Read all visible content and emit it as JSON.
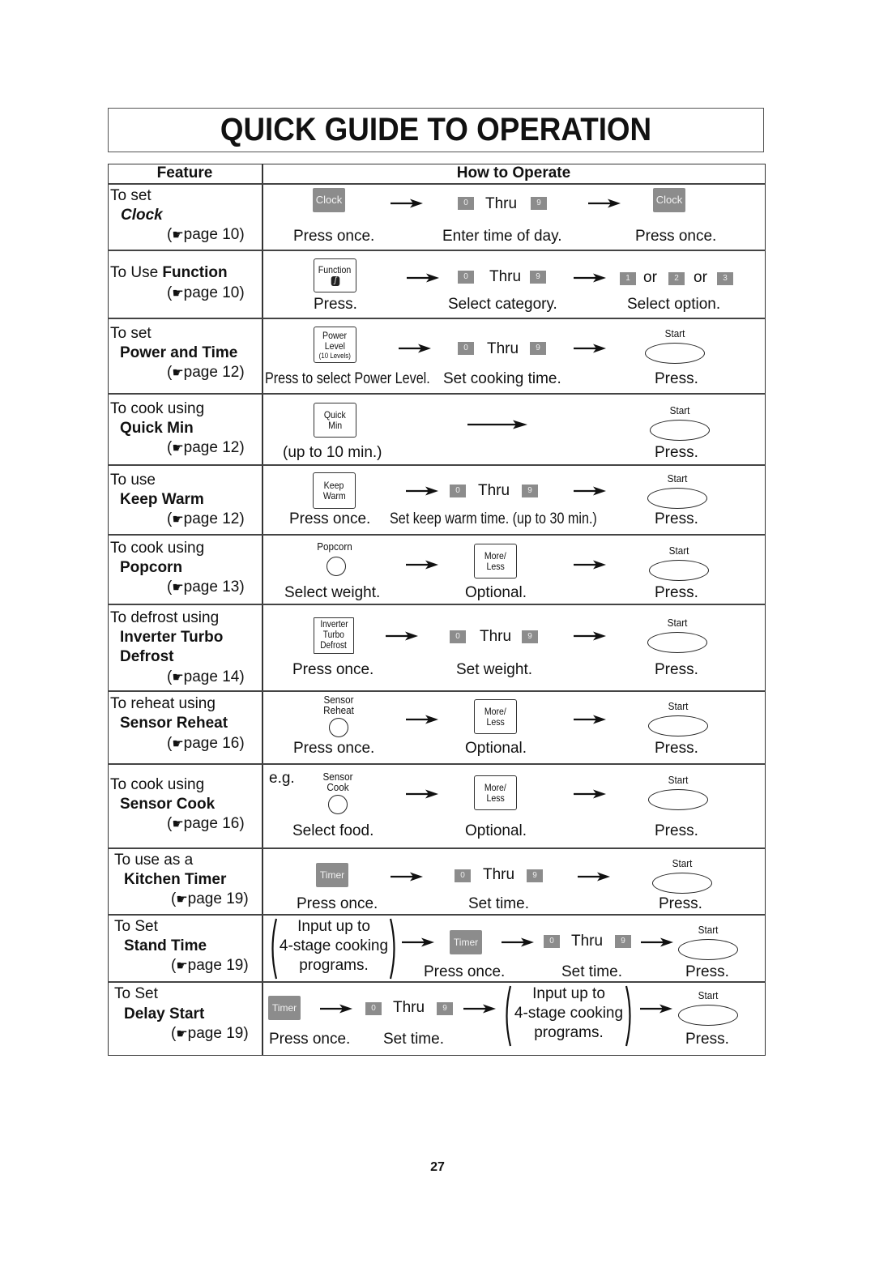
{
  "title": "QUICK GUIDE TO OPERATION",
  "header": {
    "feature": "Feature",
    "how": "How to Operate"
  },
  "page_number": "27",
  "page_ref_icon": "pointing-hand-icon",
  "common": {
    "thru": "Thru",
    "or": "or",
    "start": "Start",
    "press": "Press.",
    "press_once": "Press once.",
    "optional": "Optional.",
    "set_time": "Set time.",
    "more_less_1": "More/",
    "more_less_2": "Less",
    "key0": "0",
    "key9": "9",
    "timer": "Timer",
    "input_1": "Input up to",
    "input_2": "4-stage cooking",
    "input_3": "programs."
  },
  "rows": [
    {
      "intro": "To set",
      "name": "Clock",
      "page": "page 10)",
      "paren": "(",
      "btn": "Clock",
      "step1": "Press once.",
      "step2": "Enter time of day.",
      "step3": "Press once."
    },
    {
      "intro": "To Use ",
      "name": "Function",
      "page": "page 10)",
      "paren": "(",
      "btn": "Function",
      "step1": "Press.",
      "step2": "Select category.",
      "step3": "Select option.",
      "keys": [
        "1",
        "2",
        "3"
      ]
    },
    {
      "intro": "To set",
      "name": "Power and Time",
      "page": "page 12)",
      "paren": "(",
      "btn1": "Power",
      "btn2": "Level",
      "btn3": "(10 Levels)",
      "step1": "Press to select Power Level.",
      "step2": "Set cooking time.",
      "step3": "Press."
    },
    {
      "intro": "To cook using",
      "name": "Quick Min",
      "page": "page 12)",
      "paren": "(",
      "btn1": "Quick",
      "btn2": "Min",
      "step1": "(up to 10 min.)",
      "step3": "Press."
    },
    {
      "intro": "To use",
      "name": "Keep Warm",
      "page": "page 12)",
      "paren": "(",
      "btn1": "Keep",
      "btn2": "Warm",
      "step1": "Press once.",
      "step2": "Set keep warm time. (up to 30 min.)",
      "step3": "Press."
    },
    {
      "intro": "To cook using",
      "name": "Popcorn",
      "page": "page 13)",
      "paren": "(",
      "btn": "Popcorn",
      "step1": "Select weight.",
      "step2": "Optional.",
      "step3": "Press."
    },
    {
      "intro": "To defrost using",
      "name1": "Inverter Turbo",
      "name2": "Defrost",
      "page": "page 14)",
      "paren": "(",
      "btn1": "Inverter",
      "btn2": "Turbo",
      "btn3": "Defrost",
      "step1": "Press once.",
      "step2": "Set weight.",
      "step3": "Press."
    },
    {
      "intro": "To reheat using",
      "name": "Sensor Reheat",
      "page": "page 16)",
      "paren": "(",
      "btn1": "Sensor",
      "btn2": "Reheat",
      "step1": "Press once.",
      "step2": "Optional.",
      "step3": "Press."
    },
    {
      "intro": "To cook using",
      "name": "Sensor Cook",
      "page": "page 16)",
      "paren": "(",
      "eg": "e.g.",
      "btn1": "Sensor",
      "btn2": "Cook",
      "step1": "Select food.",
      "step2": "Optional.",
      "step3": "Press."
    },
    {
      "intro": "To use as a",
      "name": "Kitchen Timer",
      "page": "page 19)",
      "paren": "(",
      "step1": "Press once.",
      "step2": "Set time.",
      "step3": "Press."
    },
    {
      "intro": "To Set",
      "name": "Stand Time",
      "page": "page 19)",
      "paren": "(",
      "step1": "Press once.",
      "step2": "Set time.",
      "step3": "Press."
    },
    {
      "intro": "To Set",
      "name": "Delay Start",
      "page": "page 19)",
      "paren": "(",
      "step1": "Press once.",
      "step2": "Set time.",
      "step3": "Press."
    }
  ]
}
